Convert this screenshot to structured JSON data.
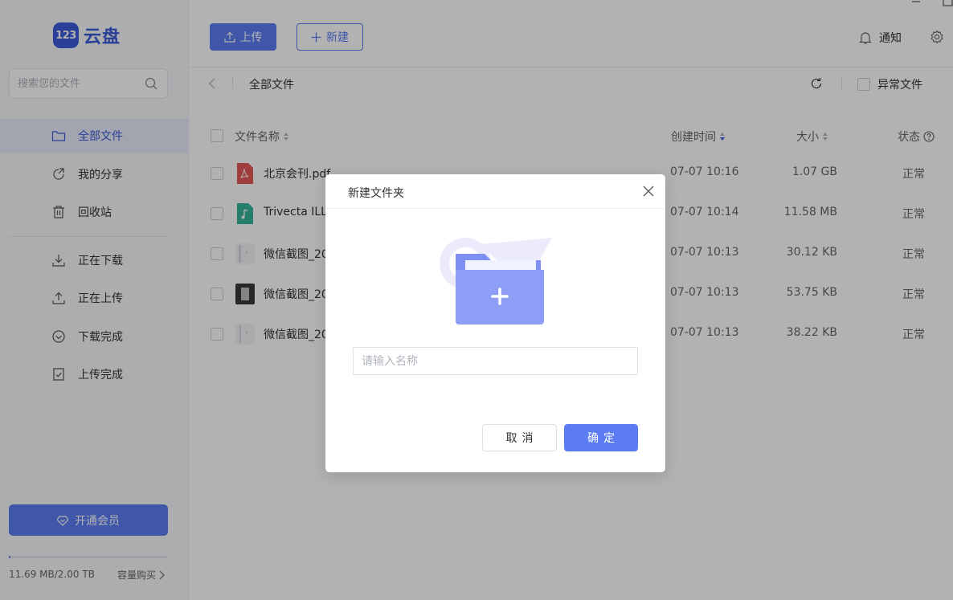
{
  "app": {
    "logo_badge": "123",
    "logo_text": "云盘"
  },
  "sidebar": {
    "search_placeholder": "搜索您的文件",
    "items": [
      {
        "label": "全部文件",
        "icon": "folder-icon",
        "active": true
      },
      {
        "label": "我的分享",
        "icon": "share-icon"
      },
      {
        "label": "回收站",
        "icon": "trash-icon"
      },
      {
        "label": "正在下载",
        "icon": "download-icon"
      },
      {
        "label": "正在上传",
        "icon": "upload-icon"
      },
      {
        "label": "下载完成",
        "icon": "download-done-icon"
      },
      {
        "label": "上传完成",
        "icon": "upload-done-icon"
      }
    ],
    "vip_label": "开通会员",
    "storage_used": "11.69 MB/2.00 TB",
    "storage_buy": "容量购买"
  },
  "topbar": {
    "upload_label": "上传",
    "new_label": "新建",
    "notify_label": "通知"
  },
  "breadcrumb": {
    "current": "全部文件",
    "abnormal_files_label": "异常文件"
  },
  "table": {
    "columns": {
      "name": "文件名称",
      "created": "创建时间",
      "size": "大小",
      "status": "状态"
    },
    "rows": [
      {
        "name": "北京会刊.pdf",
        "icon": "pdf-icon",
        "created": "07-07 10:16",
        "size": "1.07 GB",
        "status": "正常"
      },
      {
        "name": "Trivecta ILLE",
        "icon": "audio-icon",
        "created": "07-07 10:14",
        "size": "11.58 MB",
        "status": "正常"
      },
      {
        "name": "微信截图_20",
        "icon": "image-thumb-icon",
        "created": "07-07 10:13",
        "size": "30.12 KB",
        "status": "正常"
      },
      {
        "name": "微信截图_20",
        "icon": "image-thumb-icon",
        "created": "07-07 10:13",
        "size": "53.75 KB",
        "status": "正常"
      },
      {
        "name": "微信截图_20",
        "icon": "image-thumb-icon",
        "created": "07-07 10:13",
        "size": "38.22 KB",
        "status": "正常"
      }
    ]
  },
  "modal": {
    "title": "新建文件夹",
    "input_placeholder": "请输入名称",
    "input_value": "",
    "cancel_label": "取消",
    "confirm_label": "确定"
  },
  "colors": {
    "accent": "#5b7cf2",
    "brand": "#3d5bd9",
    "pdf": "#e5595a",
    "audio": "#36b39b"
  }
}
